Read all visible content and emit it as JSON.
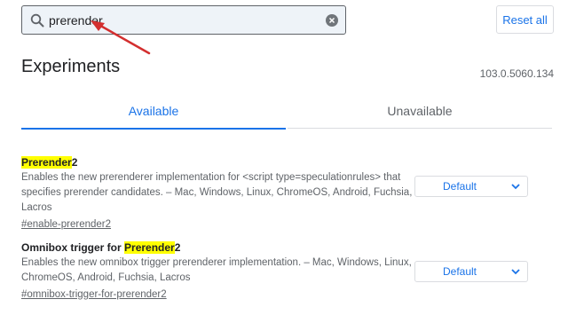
{
  "search": {
    "value": "prerender",
    "icon": "search-icon",
    "clear_icon": "close-circle-icon"
  },
  "reset_all_label": "Reset all",
  "page_title": "Experiments",
  "version": "103.0.5060.134",
  "tabs": [
    {
      "label": "Available",
      "active": true
    },
    {
      "label": "Unavailable",
      "active": false
    }
  ],
  "experiments": [
    {
      "name_highlight": "Prerender",
      "name_rest": "2",
      "description_line1": "Enables the new prerenderer implementation for <script type=speculationrules> that",
      "description_line2": "specifies prerender candidates. – Mac, Windows, Linux, ChromeOS, Android, Fuchsia, Lacros",
      "link": "#enable-prerender2",
      "select_value": "Default"
    },
    {
      "name_prefix": "Omnibox trigger for ",
      "name_highlight": "Prerender",
      "name_rest": "2",
      "description_line1": "Enables the new omnibox trigger prerenderer implementation. – Mac, Windows, Linux,",
      "description_line2": "ChromeOS, Android, Fuchsia, Lacros",
      "link": "#omnibox-trigger-for-prerender2",
      "select_value": "Default"
    }
  ],
  "colors": {
    "accent": "#1a73e8",
    "highlight": "#ffff00",
    "annotation_arrow": "#d32f2f"
  }
}
